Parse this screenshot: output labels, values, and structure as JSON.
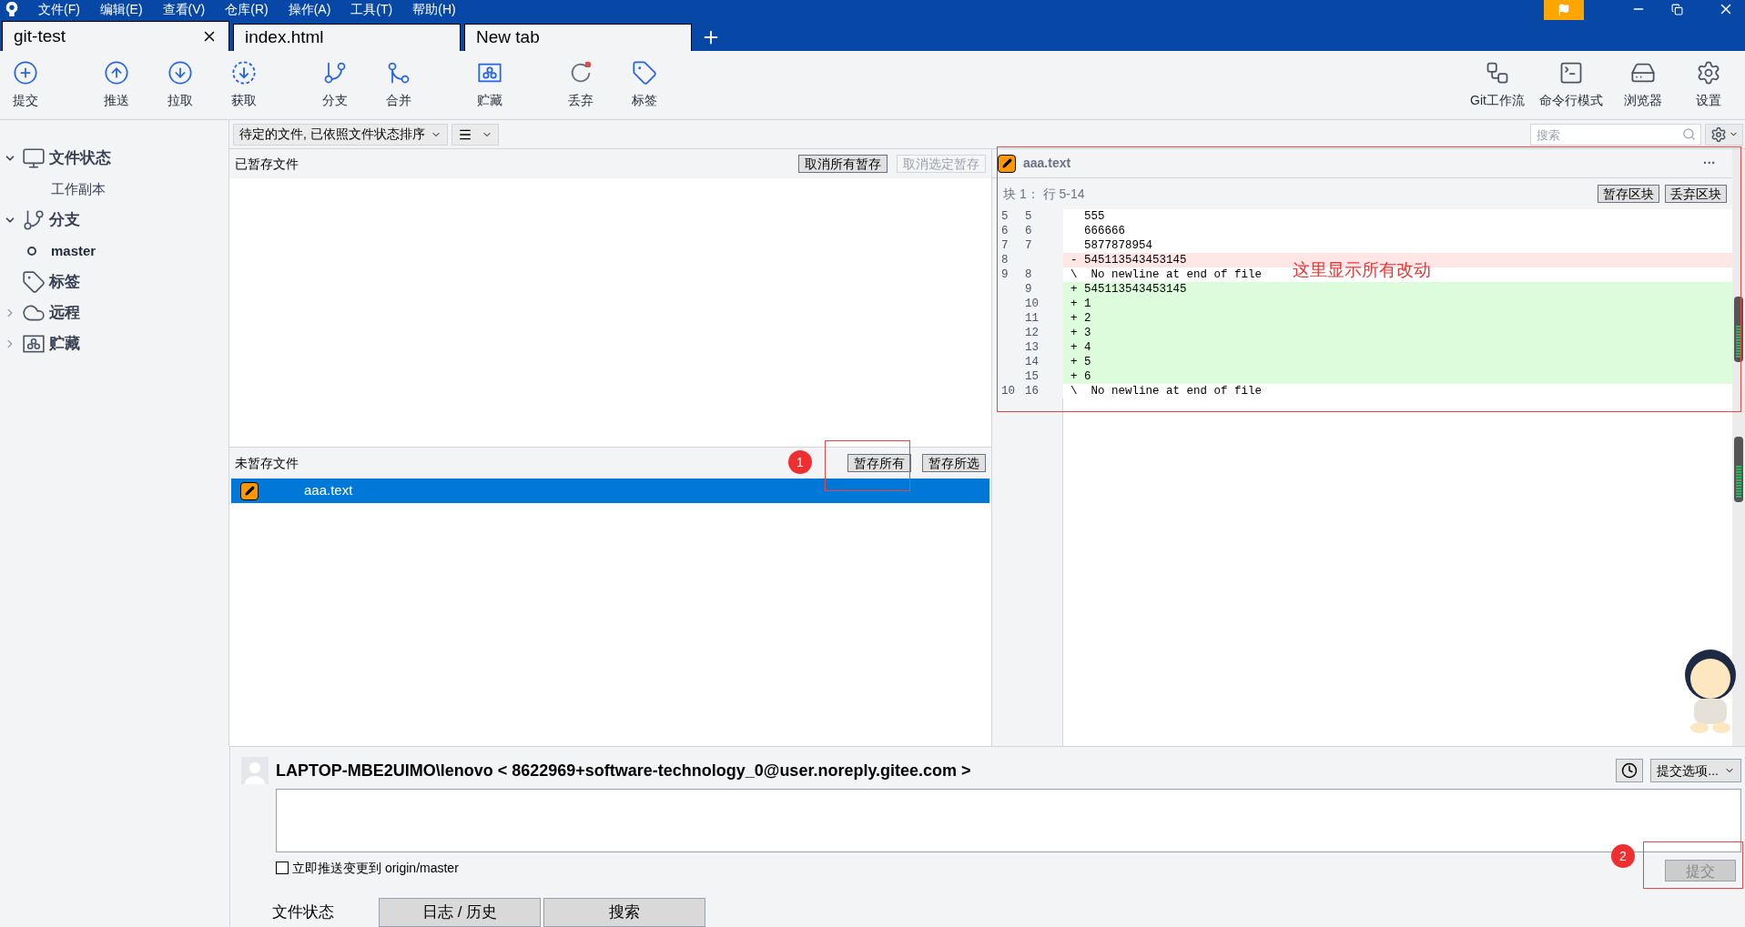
{
  "menu": [
    "文件(F)",
    "编辑(E)",
    "查看(V)",
    "仓库(R)",
    "操作(A)",
    "工具(T)",
    "帮助(H)"
  ],
  "tabs": [
    {
      "label": "git-test",
      "selected": true,
      "closable": true
    },
    {
      "label": "index.html",
      "selected": false,
      "closable": false
    },
    {
      "label": "New tab",
      "selected": false,
      "closable": false
    }
  ],
  "toolbar_left": [
    "提交",
    "推送",
    "拉取",
    "获取",
    "分支",
    "合并",
    "贮藏",
    "丢弃",
    "标签"
  ],
  "toolbar_right": [
    "Git工作流",
    "命令行模式",
    "浏览器",
    "设置"
  ],
  "filter": {
    "sort": "待定的文件, 已依照文件状态排序",
    "search_placeholder": "搜索"
  },
  "sidebar": [
    {
      "label": "文件状态",
      "expanded": true,
      "children": [
        {
          "label": "工作副本",
          "selected": false
        }
      ]
    },
    {
      "label": "分支",
      "expanded": true,
      "children": [
        {
          "label": "master",
          "selected": true
        }
      ]
    },
    {
      "label": "标签"
    },
    {
      "label": "远程",
      "expanded": false
    },
    {
      "label": "贮藏",
      "expanded": false
    }
  ],
  "staged": {
    "title": "已暂存文件",
    "buttons": [
      {
        "label": "取消所有暂存",
        "disabled": false
      },
      {
        "label": "取消选定暂存",
        "disabled": true
      }
    ]
  },
  "unstaged": {
    "title": "未暂存文件",
    "buttons": [
      {
        "label": "暂存所有",
        "disabled": false
      },
      {
        "label": "暂存所选",
        "disabled": false
      }
    ],
    "files": [
      {
        "name": "aaa.text",
        "selected": true
      }
    ]
  },
  "diff": {
    "file": "aaa.text",
    "more": "···",
    "hunk_title": "块 1： 行 5-14",
    "hunk_buttons": [
      "暂存区块",
      "丢弃区块"
    ],
    "lines": [
      {
        "old": "5",
        "new": "5",
        "kind": "context",
        "text": "555"
      },
      {
        "old": "6",
        "new": "6",
        "kind": "context",
        "text": "666666"
      },
      {
        "old": "7",
        "new": "7",
        "kind": "context",
        "text": "5877878954"
      },
      {
        "old": "8",
        "kind": "removed",
        "sign": "-",
        "text": "545113543453145"
      },
      {
        "old": "9",
        "new": "8",
        "kind": "note",
        "sign": "\\",
        "text": "No newline at end of file"
      },
      {
        "new": "9",
        "kind": "added",
        "sign": "+",
        "text": "545113543453145"
      },
      {
        "new": "10",
        "kind": "added",
        "sign": "+",
        "text": "1"
      },
      {
        "new": "11",
        "kind": "added",
        "sign": "+",
        "text": "2"
      },
      {
        "new": "12",
        "kind": "added",
        "sign": "+",
        "text": "3"
      },
      {
        "new": "13",
        "kind": "added",
        "sign": "+",
        "text": "4"
      },
      {
        "new": "14",
        "kind": "added",
        "sign": "+",
        "text": "5"
      },
      {
        "new": "15",
        "kind": "added",
        "sign": "+",
        "text": "6"
      },
      {
        "old": "10",
        "new": "16",
        "kind": "note",
        "sign": "\\",
        "text": "No newline at end of file"
      }
    ]
  },
  "annotations": {
    "note": "这里显示所有改动",
    "badges": [
      "1",
      "2"
    ]
  },
  "commit": {
    "author": "LAPTOP-MBE2UIMO\\lenovo < 8622969+software-technology_0@user.noreply.gitee.com >",
    "options": "提交选项...",
    "push": {
      "label": "立即推送变更到 origin/master",
      "checked": false
    },
    "button": {
      "label": "提交",
      "disabled": true
    }
  },
  "bottom_tabs": [
    {
      "label": "文件状态",
      "selected": true
    },
    {
      "label": "日志 / 历史",
      "selected": false
    },
    {
      "label": "搜索",
      "selected": false
    }
  ]
}
